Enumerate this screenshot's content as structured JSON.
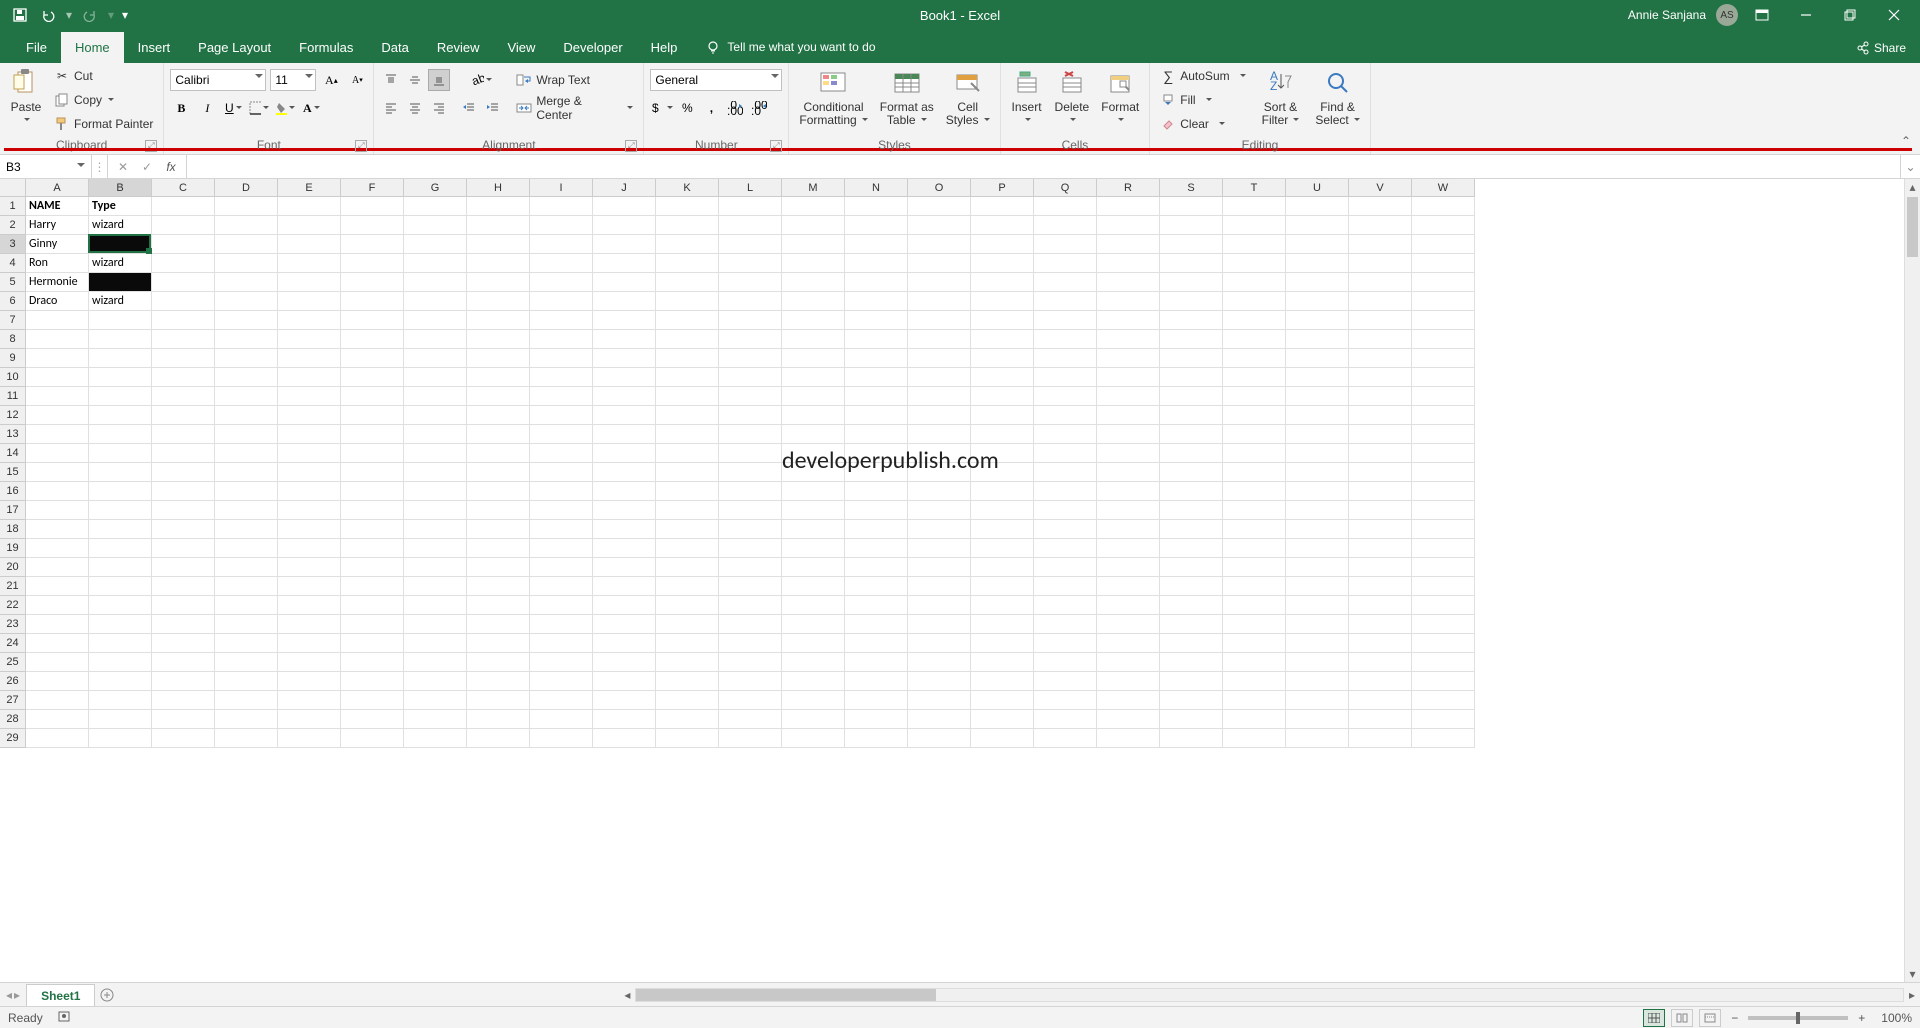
{
  "title_bar": {
    "doc_title": "Book1  -  Excel",
    "user_name": "Annie Sanjana",
    "user_initials": "AS"
  },
  "tabs": {
    "file": "File",
    "home": "Home",
    "insert": "Insert",
    "page_layout": "Page Layout",
    "formulas": "Formulas",
    "data": "Data",
    "review": "Review",
    "view": "View",
    "developer": "Developer",
    "help": "Help",
    "tell_me": "Tell me what you want to do",
    "share": "Share"
  },
  "ribbon": {
    "clipboard": {
      "paste": "Paste",
      "cut": "Cut",
      "copy": "Copy",
      "format_painter": "Format Painter",
      "label": "Clipboard"
    },
    "font": {
      "name": "Calibri",
      "size": "11",
      "label": "Font"
    },
    "alignment": {
      "wrap": "Wrap Text",
      "merge": "Merge & Center",
      "label": "Alignment"
    },
    "number": {
      "format": "General",
      "label": "Number"
    },
    "styles": {
      "cond": "Conditional\nFormatting",
      "fat": "Format as\nTable",
      "cell": "Cell\nStyles",
      "label": "Styles"
    },
    "cells": {
      "insert": "Insert",
      "delete": "Delete",
      "format": "Format",
      "label": "Cells"
    },
    "editing": {
      "autosum": "AutoSum",
      "fill": "Fill",
      "clear": "Clear",
      "sort": "Sort &\nFilter",
      "find": "Find &\nSelect",
      "label": "Editing"
    }
  },
  "name_box": "B3",
  "columns": [
    "A",
    "B",
    "C",
    "D",
    "E",
    "F",
    "G",
    "H",
    "I",
    "J",
    "K",
    "L",
    "M",
    "N",
    "O",
    "P",
    "Q",
    "R",
    "S",
    "T",
    "U",
    "V",
    "W"
  ],
  "row_count": 29,
  "selected": {
    "col": "B",
    "row": 3
  },
  "sheet_data": {
    "1": {
      "A": "NAME",
      "B": "Type"
    },
    "2": {
      "A": "Harry",
      "B": "wizard"
    },
    "3": {
      "A": "Ginny",
      "B": ""
    },
    "4": {
      "A": "Ron",
      "B": "wizard"
    },
    "5": {
      "A": "Hermonie",
      "B": ""
    },
    "6": {
      "A": "Draco",
      "B": "wizard"
    }
  },
  "bold_cells": [
    "A1",
    "B1"
  ],
  "black_cells": [
    "B3",
    "B5"
  ],
  "watermark": "developerpublish.com",
  "sheet_tab": "Sheet1",
  "status": {
    "ready": "Ready",
    "zoom": "100%"
  }
}
